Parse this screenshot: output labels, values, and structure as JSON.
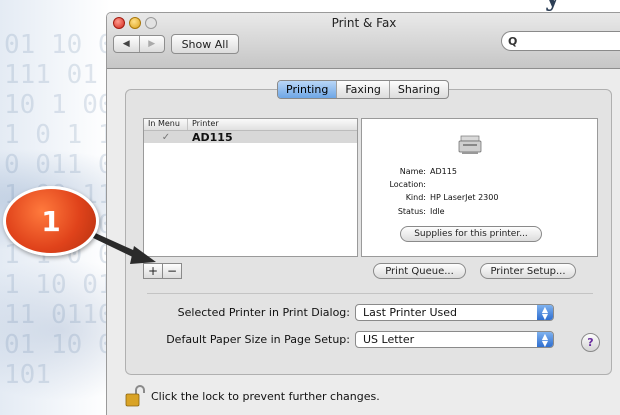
{
  "window": {
    "title": "Print & Fax",
    "show_all_label": "Show All",
    "search_placeholder": ""
  },
  "tabs": [
    {
      "label": "Printing",
      "active": true
    },
    {
      "label": "Faxing",
      "active": false
    },
    {
      "label": "Sharing",
      "active": false
    }
  ],
  "printer_list": {
    "headers": {
      "in_menu": "In Menu",
      "printer": "Printer"
    },
    "rows": [
      {
        "in_menu": "✓",
        "name": "AD115"
      }
    ]
  },
  "list_buttons": {
    "add": "+",
    "remove": "−"
  },
  "details": {
    "name_label": "Name:",
    "name_value": "AD115",
    "location_label": "Location:",
    "location_value": "",
    "kind_label": "Kind:",
    "kind_value": "HP LaserJet 2300",
    "status_label": "Status:",
    "status_value": "Idle",
    "supplies_button": "Supplies for this printer..."
  },
  "buttons": {
    "print_queue": "Print Queue...",
    "printer_setup": "Printer Setup..."
  },
  "preferences": {
    "selected_printer_label": "Selected Printer in Print Dialog:",
    "selected_printer_value": "Last Printer Used",
    "paper_size_label": "Default Paper Size in Page Setup:",
    "paper_size_value": "US Letter",
    "help": "?"
  },
  "lock": {
    "text": "Click the lock to prevent further changes."
  },
  "callout": {
    "number": "1"
  },
  "colors": {
    "accent": "#2f6fd0",
    "callout": "#e0431b",
    "tab_active": "#6ea6e6"
  },
  "icons": [
    "printer-icon",
    "lock-icon",
    "search-icon",
    "back-arrow-icon",
    "forward-arrow-icon",
    "popup-arrows-icon",
    "checkmark-icon"
  ]
}
